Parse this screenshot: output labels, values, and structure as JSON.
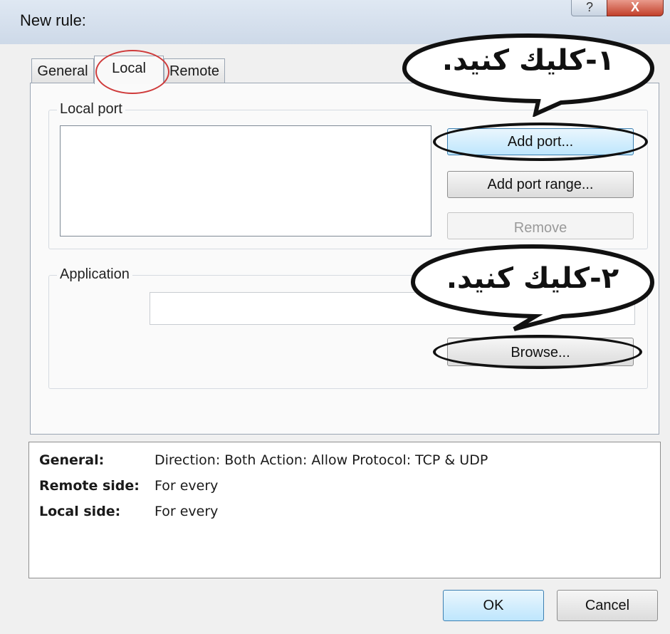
{
  "window": {
    "title": "New rule:",
    "help_icon": "?",
    "close_icon": "X"
  },
  "tabs": [
    {
      "label": "General",
      "active": false
    },
    {
      "label": "Local",
      "active": true
    },
    {
      "label": "Remote",
      "active": false
    }
  ],
  "local_port": {
    "group_label": "Local port",
    "buttons": {
      "add_port": "Add port...",
      "add_port_range": "Add port range...",
      "remove": "Remove"
    }
  },
  "application": {
    "group_label": "Application",
    "path_value": "",
    "browse_button": "Browse..."
  },
  "summary": [
    {
      "key": "General:",
      "value": "Direction: Both   Action: Allow   Protocol: TCP & UDP"
    },
    {
      "key": "Remote side:",
      "value": "For every"
    },
    {
      "key": "Local side:",
      "value": "For every"
    }
  ],
  "footer": {
    "ok": "OK",
    "cancel": "Cancel"
  },
  "annotations": {
    "callout_1": "۱-كليك كنيد.",
    "callout_2": "۲-كليك كنيد."
  },
  "colors": {
    "tab_highlight": "#cf3b3b",
    "primary_button": "#bee6fd",
    "close_button": "#c2402a"
  }
}
